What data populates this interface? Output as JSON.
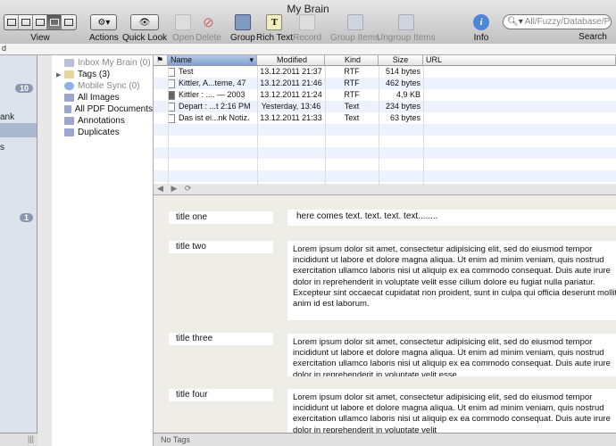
{
  "window": {
    "title": "My Brain"
  },
  "toolbar": {
    "view_label": "View",
    "actions_label": "Actions",
    "quicklook_label": "Quick Look",
    "open_label": "Open",
    "delete_label": "Delete",
    "group_label": "Group",
    "richtext_label": "Rich Text",
    "record_label": "Record",
    "group_items_label": "Group Items",
    "ungroup_items_label": "Ungroup Items",
    "info_label": "Info",
    "search_label": "Search",
    "search_placeholder": "All/Fuzzy/Database/Prefix"
  },
  "pathbar": {
    "text": "d"
  },
  "left_sidebar": {
    "badge1": "10",
    "badge2": "1",
    "text1": "ank",
    "text2": "s"
  },
  "groups": [
    {
      "label": "Inbox My Brain (0)",
      "dim": true,
      "icon": "inbox-icon"
    },
    {
      "label": "Tags (3)",
      "dim": false,
      "icon": "tag-icon"
    },
    {
      "label": "Mobile Sync (0)",
      "dim": true,
      "icon": "sync-icon"
    },
    {
      "label": "All Images",
      "dim": false,
      "icon": "folder-icon"
    },
    {
      "label": "All PDF Documents",
      "dim": false,
      "icon": "folder-icon"
    },
    {
      "label": "Annotations",
      "dim": false,
      "icon": "folder-icon"
    },
    {
      "label": "Duplicates",
      "dim": false,
      "icon": "folder-icon"
    }
  ],
  "list": {
    "headers": {
      "name": "Name",
      "modified": "Modified",
      "kind": "Kind",
      "size": "Size",
      "url": "URL"
    },
    "rows": [
      {
        "name": "Test",
        "modified": "13.12.2011 21:37",
        "kind": "RTF",
        "size": "514 bytes"
      },
      {
        "name": "Kittler, A...teme, 47",
        "modified": "13.12.2011 21:46",
        "kind": "RTF",
        "size": "462 bytes"
      },
      {
        "name": "Kittler : .... — 2003",
        "modified": "13.12.2011 21:24",
        "kind": "RTF",
        "size": "4,9 KB"
      },
      {
        "name": "Depart : ...t 2:16 PM",
        "modified": "Yesterday, 13:46",
        "kind": "Text",
        "size": "234 bytes"
      },
      {
        "name": "Das ist ei...nk Notiz.",
        "modified": "13.12.2011 21:33",
        "kind": "Text",
        "size": "63 bytes"
      }
    ]
  },
  "content": {
    "items": [
      {
        "title": "title one",
        "text": "here comes text. text. text. text........"
      },
      {
        "title": "title two",
        "text": "Lorem ipsum dolor sit amet, consectetur adipisicing elit, sed do eiusmod tempor incididunt ut labore et dolore magna aliqua. Ut enim ad minim veniam, quis nostrud exercitation ullamco laboris nisi ut aliquip ex ea commodo consequat. Duis aute irure dolor in reprehenderit in voluptate velit esse cillum dolore eu fugiat nulla pariatur. Excepteur sint occaecat cupidatat non proident, sunt in culpa qui officia deserunt mollit anim id est laborum."
      },
      {
        "title": "title three",
        "text": "Lorem ipsum dolor sit amet, consectetur adipisicing elit, sed do eiusmod tempor incididunt ut labore et dolore magna aliqua. Ut enim ad minim veniam, quis nostrud exercitation ullamco laboris nisi ut aliquip ex ea commodo consequat. Duis aute irure dolor in reprehenderit in voluptate velit esse"
      },
      {
        "title": "title four",
        "text": "Lorem ipsum dolor sit amet, consectetur adipisicing elit, sed do eiusmod tempor incididunt ut labore et dolore magna aliqua. Ut enim ad minim veniam, quis nostrud exercitation ullamco laboris nisi ut aliquip ex ea commodo consequat. Duis aute irure dolor in reprehenderit in voluptate velit"
      }
    ]
  },
  "statusbar": {
    "text": "No Tags"
  }
}
